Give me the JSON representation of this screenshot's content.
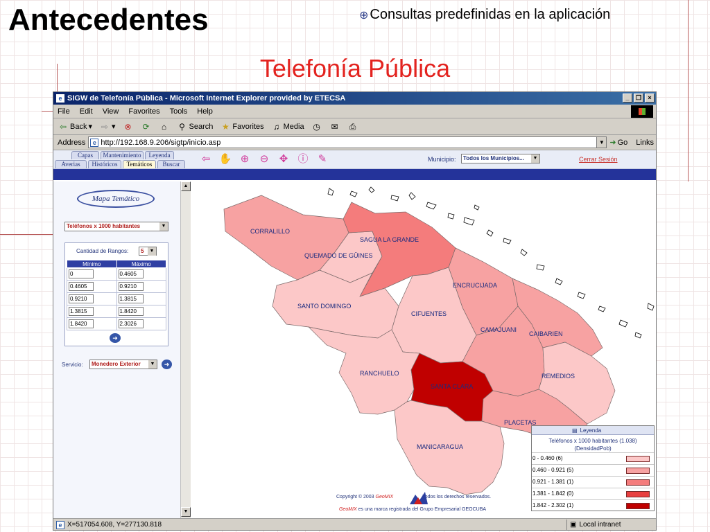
{
  "slide": {
    "title": "Antecedentes",
    "bullet": "Consultas predefinidas en la aplicación",
    "subtitle": "Telefonía Pública"
  },
  "browser": {
    "title": "SIGW de Telefonía Pública - Microsoft Internet Explorer provided by ETECSA",
    "menu": [
      "File",
      "Edit",
      "View",
      "Favorites",
      "Tools",
      "Help"
    ],
    "toolbar": {
      "back": "Back",
      "search": "Search",
      "favorites": "Favorites",
      "media": "Media"
    },
    "address_label": "Address",
    "address_value": "http://192.168.9.206/sigtp/inicio.asp",
    "go_label": "Go",
    "links_label": "Links",
    "status_coords": "X=517054.608, Y=277130.818",
    "status_zone": "Local intranet"
  },
  "app": {
    "tabs_top": [
      "Capas",
      "Mantenimiento",
      "Leyenda"
    ],
    "tabs_bottom": [
      "Averias",
      "Históricos",
      "Temáticos",
      "Buscar"
    ],
    "active_tab": "Temáticos",
    "municipio_label": "Municipio:",
    "municipio_value": "Todos los Municipios...",
    "logout_label": "Cerrar Sesión"
  },
  "panel": {
    "title": "Mapa Temático",
    "indicator": "Teléfonos x 1000 habitantes",
    "ranges_label": "Cantidad de Rangos:",
    "ranges_value": "5",
    "col_min": "Mínimo",
    "col_max": "Máximo",
    "rows": [
      {
        "min": "0",
        "max": "0.4605"
      },
      {
        "min": "0.4605",
        "max": "0.9210"
      },
      {
        "min": "0.9210",
        "max": "1.3815"
      },
      {
        "min": "1.3815",
        "max": "1.8420"
      },
      {
        "min": "1.8420",
        "max": "2.3026"
      }
    ],
    "service_label": "Servicio:",
    "service_value": "Monedero Exterior"
  },
  "map": {
    "municipalities": [
      "CORRALILLO",
      "SAGUA LA GRANDE",
      "QUEMADO DE GÜINES",
      "ENCRUCIJADA",
      "SANTO DOMINGO",
      "CIFUENTES",
      "CAMAJUANI",
      "CAIBARIEN",
      "RANCHUELO",
      "REMEDIOS",
      "SANTA CLARA",
      "PLACETAS",
      "MANICARAGUA"
    ],
    "colors": {
      "c1": "#fcc8c8",
      "c2": "#f7a2a2",
      "c3": "#f47c7c",
      "c4": "#e84040",
      "c5": "#c00000"
    }
  },
  "legend": {
    "header": "Leyenda",
    "title_line1": "Teléfonos x 1000 habitantes (1.038)",
    "title_line2": "(DensidadPob)",
    "rows": [
      {
        "label": "0 - 0.460 (6)",
        "color": "#fcc8c8"
      },
      {
        "label": "0.460 - 0.921 (5)",
        "color": "#f7a2a2"
      },
      {
        "label": "0.921 - 1.381 (1)",
        "color": "#f47c7c"
      },
      {
        "label": "1.381 - 1.842 (0)",
        "color": "#e84040"
      },
      {
        "label": "1.842 - 2.302 (1)",
        "color": "#c00000"
      }
    ]
  },
  "footer": {
    "copyright_pre": "Copyright © 2003",
    "brand": "GeoMIX",
    "copyright_post": "Todos los derechos reservados.",
    "trademark": "es una marca registrada del Grupo Empresarial GEOCUBA"
  }
}
